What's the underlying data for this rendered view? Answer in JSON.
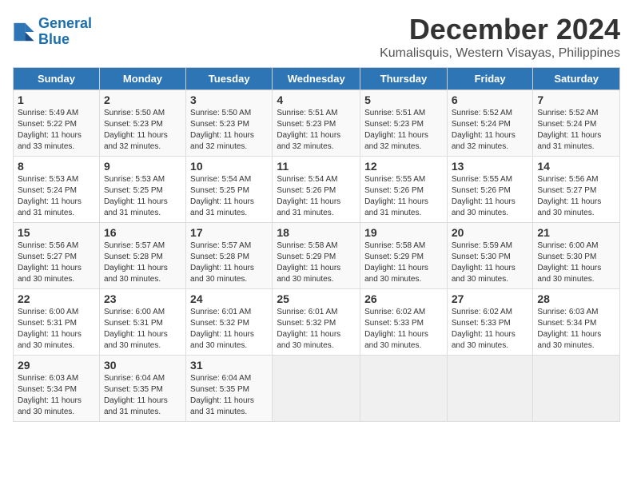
{
  "logo": {
    "line1": "General",
    "line2": "Blue"
  },
  "title": "December 2024",
  "location": "Kumalisquis, Western Visayas, Philippines",
  "weekdays": [
    "Sunday",
    "Monday",
    "Tuesday",
    "Wednesday",
    "Thursday",
    "Friday",
    "Saturday"
  ],
  "weeks": [
    [
      {
        "day": "1",
        "info": "Sunrise: 5:49 AM\nSunset: 5:22 PM\nDaylight: 11 hours\nand 33 minutes."
      },
      {
        "day": "2",
        "info": "Sunrise: 5:50 AM\nSunset: 5:23 PM\nDaylight: 11 hours\nand 32 minutes."
      },
      {
        "day": "3",
        "info": "Sunrise: 5:50 AM\nSunset: 5:23 PM\nDaylight: 11 hours\nand 32 minutes."
      },
      {
        "day": "4",
        "info": "Sunrise: 5:51 AM\nSunset: 5:23 PM\nDaylight: 11 hours\nand 32 minutes."
      },
      {
        "day": "5",
        "info": "Sunrise: 5:51 AM\nSunset: 5:23 PM\nDaylight: 11 hours\nand 32 minutes."
      },
      {
        "day": "6",
        "info": "Sunrise: 5:52 AM\nSunset: 5:24 PM\nDaylight: 11 hours\nand 32 minutes."
      },
      {
        "day": "7",
        "info": "Sunrise: 5:52 AM\nSunset: 5:24 PM\nDaylight: 11 hours\nand 31 minutes."
      }
    ],
    [
      {
        "day": "8",
        "info": "Sunrise: 5:53 AM\nSunset: 5:24 PM\nDaylight: 11 hours\nand 31 minutes."
      },
      {
        "day": "9",
        "info": "Sunrise: 5:53 AM\nSunset: 5:25 PM\nDaylight: 11 hours\nand 31 minutes."
      },
      {
        "day": "10",
        "info": "Sunrise: 5:54 AM\nSunset: 5:25 PM\nDaylight: 11 hours\nand 31 minutes."
      },
      {
        "day": "11",
        "info": "Sunrise: 5:54 AM\nSunset: 5:26 PM\nDaylight: 11 hours\nand 31 minutes."
      },
      {
        "day": "12",
        "info": "Sunrise: 5:55 AM\nSunset: 5:26 PM\nDaylight: 11 hours\nand 31 minutes."
      },
      {
        "day": "13",
        "info": "Sunrise: 5:55 AM\nSunset: 5:26 PM\nDaylight: 11 hours\nand 30 minutes."
      },
      {
        "day": "14",
        "info": "Sunrise: 5:56 AM\nSunset: 5:27 PM\nDaylight: 11 hours\nand 30 minutes."
      }
    ],
    [
      {
        "day": "15",
        "info": "Sunrise: 5:56 AM\nSunset: 5:27 PM\nDaylight: 11 hours\nand 30 minutes."
      },
      {
        "day": "16",
        "info": "Sunrise: 5:57 AM\nSunset: 5:28 PM\nDaylight: 11 hours\nand 30 minutes."
      },
      {
        "day": "17",
        "info": "Sunrise: 5:57 AM\nSunset: 5:28 PM\nDaylight: 11 hours\nand 30 minutes."
      },
      {
        "day": "18",
        "info": "Sunrise: 5:58 AM\nSunset: 5:29 PM\nDaylight: 11 hours\nand 30 minutes."
      },
      {
        "day": "19",
        "info": "Sunrise: 5:58 AM\nSunset: 5:29 PM\nDaylight: 11 hours\nand 30 minutes."
      },
      {
        "day": "20",
        "info": "Sunrise: 5:59 AM\nSunset: 5:30 PM\nDaylight: 11 hours\nand 30 minutes."
      },
      {
        "day": "21",
        "info": "Sunrise: 6:00 AM\nSunset: 5:30 PM\nDaylight: 11 hours\nand 30 minutes."
      }
    ],
    [
      {
        "day": "22",
        "info": "Sunrise: 6:00 AM\nSunset: 5:31 PM\nDaylight: 11 hours\nand 30 minutes."
      },
      {
        "day": "23",
        "info": "Sunrise: 6:00 AM\nSunset: 5:31 PM\nDaylight: 11 hours\nand 30 minutes."
      },
      {
        "day": "24",
        "info": "Sunrise: 6:01 AM\nSunset: 5:32 PM\nDaylight: 11 hours\nand 30 minutes."
      },
      {
        "day": "25",
        "info": "Sunrise: 6:01 AM\nSunset: 5:32 PM\nDaylight: 11 hours\nand 30 minutes."
      },
      {
        "day": "26",
        "info": "Sunrise: 6:02 AM\nSunset: 5:33 PM\nDaylight: 11 hours\nand 30 minutes."
      },
      {
        "day": "27",
        "info": "Sunrise: 6:02 AM\nSunset: 5:33 PM\nDaylight: 11 hours\nand 30 minutes."
      },
      {
        "day": "28",
        "info": "Sunrise: 6:03 AM\nSunset: 5:34 PM\nDaylight: 11 hours\nand 30 minutes."
      }
    ],
    [
      {
        "day": "29",
        "info": "Sunrise: 6:03 AM\nSunset: 5:34 PM\nDaylight: 11 hours\nand 30 minutes."
      },
      {
        "day": "30",
        "info": "Sunrise: 6:04 AM\nSunset: 5:35 PM\nDaylight: 11 hours\nand 31 minutes."
      },
      {
        "day": "31",
        "info": "Sunrise: 6:04 AM\nSunset: 5:35 PM\nDaylight: 11 hours\nand 31 minutes."
      },
      null,
      null,
      null,
      null
    ]
  ]
}
